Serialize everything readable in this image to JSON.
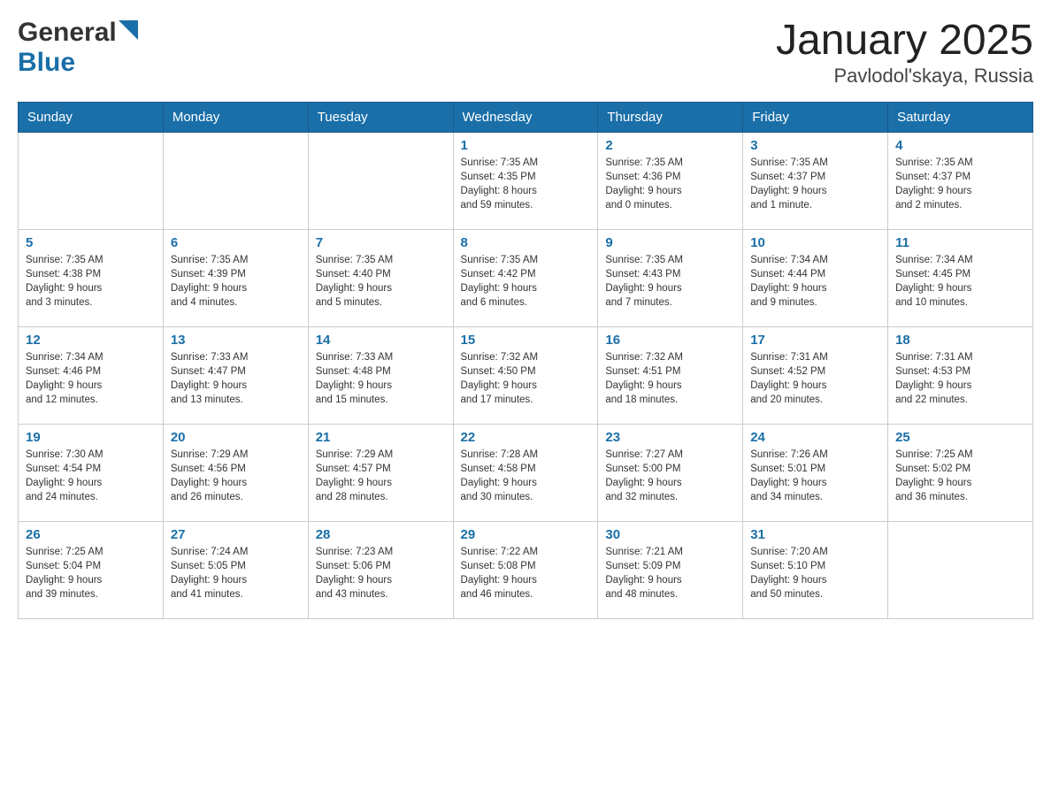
{
  "header": {
    "title": "January 2025",
    "subtitle": "Pavlodol'skaya, Russia"
  },
  "days_of_week": [
    "Sunday",
    "Monday",
    "Tuesday",
    "Wednesday",
    "Thursday",
    "Friday",
    "Saturday"
  ],
  "weeks": [
    [
      {
        "day": "",
        "info": ""
      },
      {
        "day": "",
        "info": ""
      },
      {
        "day": "",
        "info": ""
      },
      {
        "day": "1",
        "info": "Sunrise: 7:35 AM\nSunset: 4:35 PM\nDaylight: 8 hours\nand 59 minutes."
      },
      {
        "day": "2",
        "info": "Sunrise: 7:35 AM\nSunset: 4:36 PM\nDaylight: 9 hours\nand 0 minutes."
      },
      {
        "day": "3",
        "info": "Sunrise: 7:35 AM\nSunset: 4:37 PM\nDaylight: 9 hours\nand 1 minute."
      },
      {
        "day": "4",
        "info": "Sunrise: 7:35 AM\nSunset: 4:37 PM\nDaylight: 9 hours\nand 2 minutes."
      }
    ],
    [
      {
        "day": "5",
        "info": "Sunrise: 7:35 AM\nSunset: 4:38 PM\nDaylight: 9 hours\nand 3 minutes."
      },
      {
        "day": "6",
        "info": "Sunrise: 7:35 AM\nSunset: 4:39 PM\nDaylight: 9 hours\nand 4 minutes."
      },
      {
        "day": "7",
        "info": "Sunrise: 7:35 AM\nSunset: 4:40 PM\nDaylight: 9 hours\nand 5 minutes."
      },
      {
        "day": "8",
        "info": "Sunrise: 7:35 AM\nSunset: 4:42 PM\nDaylight: 9 hours\nand 6 minutes."
      },
      {
        "day": "9",
        "info": "Sunrise: 7:35 AM\nSunset: 4:43 PM\nDaylight: 9 hours\nand 7 minutes."
      },
      {
        "day": "10",
        "info": "Sunrise: 7:34 AM\nSunset: 4:44 PM\nDaylight: 9 hours\nand 9 minutes."
      },
      {
        "day": "11",
        "info": "Sunrise: 7:34 AM\nSunset: 4:45 PM\nDaylight: 9 hours\nand 10 minutes."
      }
    ],
    [
      {
        "day": "12",
        "info": "Sunrise: 7:34 AM\nSunset: 4:46 PM\nDaylight: 9 hours\nand 12 minutes."
      },
      {
        "day": "13",
        "info": "Sunrise: 7:33 AM\nSunset: 4:47 PM\nDaylight: 9 hours\nand 13 minutes."
      },
      {
        "day": "14",
        "info": "Sunrise: 7:33 AM\nSunset: 4:48 PM\nDaylight: 9 hours\nand 15 minutes."
      },
      {
        "day": "15",
        "info": "Sunrise: 7:32 AM\nSunset: 4:50 PM\nDaylight: 9 hours\nand 17 minutes."
      },
      {
        "day": "16",
        "info": "Sunrise: 7:32 AM\nSunset: 4:51 PM\nDaylight: 9 hours\nand 18 minutes."
      },
      {
        "day": "17",
        "info": "Sunrise: 7:31 AM\nSunset: 4:52 PM\nDaylight: 9 hours\nand 20 minutes."
      },
      {
        "day": "18",
        "info": "Sunrise: 7:31 AM\nSunset: 4:53 PM\nDaylight: 9 hours\nand 22 minutes."
      }
    ],
    [
      {
        "day": "19",
        "info": "Sunrise: 7:30 AM\nSunset: 4:54 PM\nDaylight: 9 hours\nand 24 minutes."
      },
      {
        "day": "20",
        "info": "Sunrise: 7:29 AM\nSunset: 4:56 PM\nDaylight: 9 hours\nand 26 minutes."
      },
      {
        "day": "21",
        "info": "Sunrise: 7:29 AM\nSunset: 4:57 PM\nDaylight: 9 hours\nand 28 minutes."
      },
      {
        "day": "22",
        "info": "Sunrise: 7:28 AM\nSunset: 4:58 PM\nDaylight: 9 hours\nand 30 minutes."
      },
      {
        "day": "23",
        "info": "Sunrise: 7:27 AM\nSunset: 5:00 PM\nDaylight: 9 hours\nand 32 minutes."
      },
      {
        "day": "24",
        "info": "Sunrise: 7:26 AM\nSunset: 5:01 PM\nDaylight: 9 hours\nand 34 minutes."
      },
      {
        "day": "25",
        "info": "Sunrise: 7:25 AM\nSunset: 5:02 PM\nDaylight: 9 hours\nand 36 minutes."
      }
    ],
    [
      {
        "day": "26",
        "info": "Sunrise: 7:25 AM\nSunset: 5:04 PM\nDaylight: 9 hours\nand 39 minutes."
      },
      {
        "day": "27",
        "info": "Sunrise: 7:24 AM\nSunset: 5:05 PM\nDaylight: 9 hours\nand 41 minutes."
      },
      {
        "day": "28",
        "info": "Sunrise: 7:23 AM\nSunset: 5:06 PM\nDaylight: 9 hours\nand 43 minutes."
      },
      {
        "day": "29",
        "info": "Sunrise: 7:22 AM\nSunset: 5:08 PM\nDaylight: 9 hours\nand 46 minutes."
      },
      {
        "day": "30",
        "info": "Sunrise: 7:21 AM\nSunset: 5:09 PM\nDaylight: 9 hours\nand 48 minutes."
      },
      {
        "day": "31",
        "info": "Sunrise: 7:20 AM\nSunset: 5:10 PM\nDaylight: 9 hours\nand 50 minutes."
      },
      {
        "day": "",
        "info": ""
      }
    ]
  ]
}
